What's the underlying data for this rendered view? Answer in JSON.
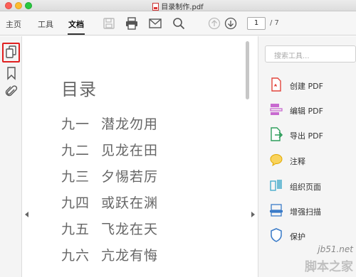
{
  "window": {
    "title": "目录制作.pdf"
  },
  "toolbar": {
    "tabs": [
      {
        "label": "主页"
      },
      {
        "label": "工具"
      },
      {
        "label": "文档"
      }
    ],
    "current_page": "1",
    "total_pages": "/ 7"
  },
  "left_rail": {
    "icons": [
      "page-thumbnails-icon",
      "bookmark-icon",
      "attachment-icon"
    ]
  },
  "document": {
    "heading": "目录",
    "entries": [
      {
        "num": "九一",
        "text": "潜龙勿用"
      },
      {
        "num": "九二",
        "text": "见龙在田"
      },
      {
        "num": "九三",
        "text": "夕惕若厉"
      },
      {
        "num": "九四",
        "text": "或跃在渊"
      },
      {
        "num": "九五",
        "text": "飞龙在天"
      },
      {
        "num": "九六",
        "text": "亢龙有悔"
      }
    ]
  },
  "right_panel": {
    "search_placeholder": "搜索工具...",
    "tools": [
      {
        "label": "创建 PDF",
        "icon": "create-pdf-icon",
        "color": "#e2453c"
      },
      {
        "label": "编辑 PDF",
        "icon": "edit-pdf-icon",
        "color": "#c86ad0"
      },
      {
        "label": "导出 PDF",
        "icon": "export-pdf-icon",
        "color": "#2f9e5c"
      },
      {
        "label": "注释",
        "icon": "comment-icon",
        "color": "#f4b400"
      },
      {
        "label": "组织页面",
        "icon": "organize-pages-icon",
        "color": "#3aa7c8"
      },
      {
        "label": "增强扫描",
        "icon": "enhance-scan-icon",
        "color": "#3a7bc8"
      },
      {
        "label": "保护",
        "icon": "protect-icon",
        "color": "#3a7bc8"
      }
    ]
  },
  "watermark": {
    "url": "jb51.net",
    "name": "脚本之家"
  },
  "colors": {
    "highlight": "#e02020",
    "arrow": "#e02020"
  }
}
